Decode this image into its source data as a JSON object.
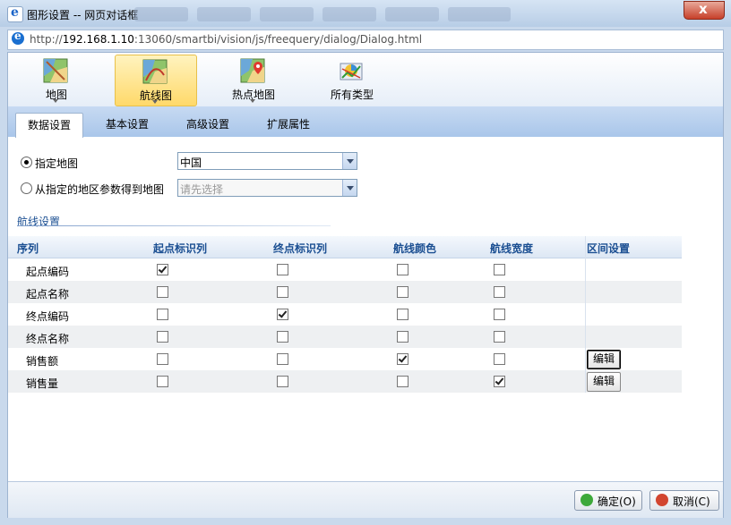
{
  "window": {
    "title": "图形设置 -- 网页对话框",
    "close_glyph": "x"
  },
  "address": {
    "prefix": "http://",
    "host": "192.168.1.10",
    "rest": ":13060/smartbi/vision/js/freequery/dialog/Dialog.html"
  },
  "toolbar": {
    "items": [
      {
        "label": "地图",
        "icon": "map-icon",
        "active": false
      },
      {
        "label": "航线图",
        "icon": "route-map-icon",
        "active": true
      },
      {
        "label": "热点地图",
        "icon": "hotspot-map-icon",
        "active": false
      },
      {
        "label": "所有类型",
        "icon": "all-types-icon",
        "active": false
      }
    ]
  },
  "tabs": [
    {
      "label": "数据设置",
      "active": true
    },
    {
      "label": "基本设置",
      "active": false
    },
    {
      "label": "高级设置",
      "active": false
    },
    {
      "label": "扩展属性",
      "active": false
    }
  ],
  "map_source": {
    "option_specified": {
      "label": "指定地图",
      "selected": true,
      "value": "中国"
    },
    "option_param": {
      "label": "从指定的地区参数得到地图",
      "selected": false,
      "placeholder": "请先选择"
    }
  },
  "route_settings": {
    "title": "航线设置",
    "columns": [
      "序列",
      "起点标识列",
      "终点标识列",
      "航线颜色",
      "航线宽度",
      "区间设置"
    ],
    "rows": [
      {
        "name": "起点编码",
        "checks": [
          true,
          false,
          false,
          false
        ],
        "edit": ""
      },
      {
        "name": "起点名称",
        "checks": [
          false,
          false,
          false,
          false
        ],
        "edit": ""
      },
      {
        "name": "终点编码",
        "checks": [
          false,
          true,
          false,
          false
        ],
        "edit": ""
      },
      {
        "name": "终点名称",
        "checks": [
          false,
          false,
          false,
          false
        ],
        "edit": ""
      },
      {
        "name": "销售额",
        "checks": [
          false,
          false,
          true,
          false
        ],
        "edit": "编辑"
      },
      {
        "name": "销售量",
        "checks": [
          false,
          false,
          false,
          true
        ],
        "edit": "编辑"
      }
    ]
  },
  "footer": {
    "ok_label": "确定(O)",
    "cancel_label": "取消(C)"
  },
  "colors": {
    "header_text": "#1b4f92",
    "active_toolbar": "#ffd96a",
    "ok_icon": "#3ea93a",
    "cancel_icon": "#d2452f"
  }
}
